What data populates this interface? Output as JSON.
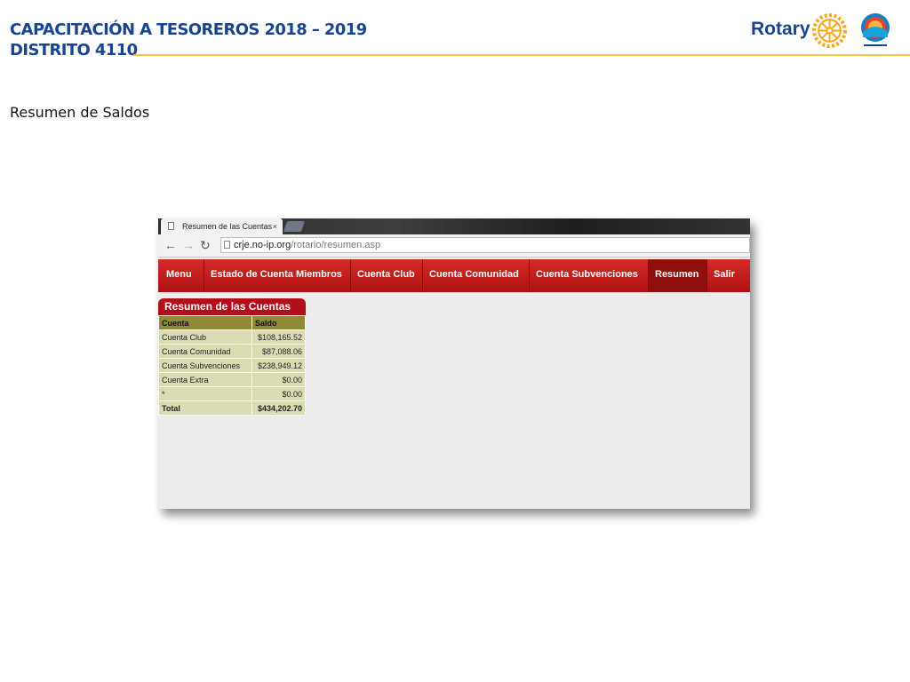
{
  "slide": {
    "title_line1": "CAPACITACIÓN A TESOREROS 2018 – 2019",
    "title_line2": "DISTRITO 4110",
    "logo_text": "Rotary",
    "subtitle": "Resumen de Saldos",
    "accent_color": "#f7c342",
    "brand_color": "#17458f"
  },
  "browser": {
    "tab_title": "Resumen de las Cuentas",
    "tab_close": "×",
    "url_domain": "crje.no-ip.org",
    "url_path": "/rotario/resumen.asp",
    "back_icon": "arrow-left-icon",
    "forward_icon": "arrow-right-icon",
    "reload_icon": "reload-icon"
  },
  "menu": {
    "items": [
      "Menu",
      "Estado de Cuenta Miembros",
      "Cuenta Club",
      "Cuenta Comunidad",
      "Cuenta Subvenciones",
      "Resumen",
      "Salir"
    ],
    "active": "Resumen",
    "bar_color": "#c21d1d"
  },
  "summary": {
    "title": "Resumen de las Cuentas",
    "headers": [
      "Cuenta",
      "Saldo"
    ],
    "rows": [
      {
        "cuenta": "Cuenta Club",
        "saldo": "$108,165.52"
      },
      {
        "cuenta": "Cuenta Comunidad",
        "saldo": "$87,088.06"
      },
      {
        "cuenta": "Cuenta Subvenciones",
        "saldo": "$238,949.12"
      },
      {
        "cuenta": "Cuenta Extra",
        "saldo": "$0.00"
      },
      {
        "cuenta": "*",
        "saldo": "$0.00"
      }
    ],
    "total": {
      "cuenta": "Total",
      "saldo": "$434,202.70"
    }
  }
}
